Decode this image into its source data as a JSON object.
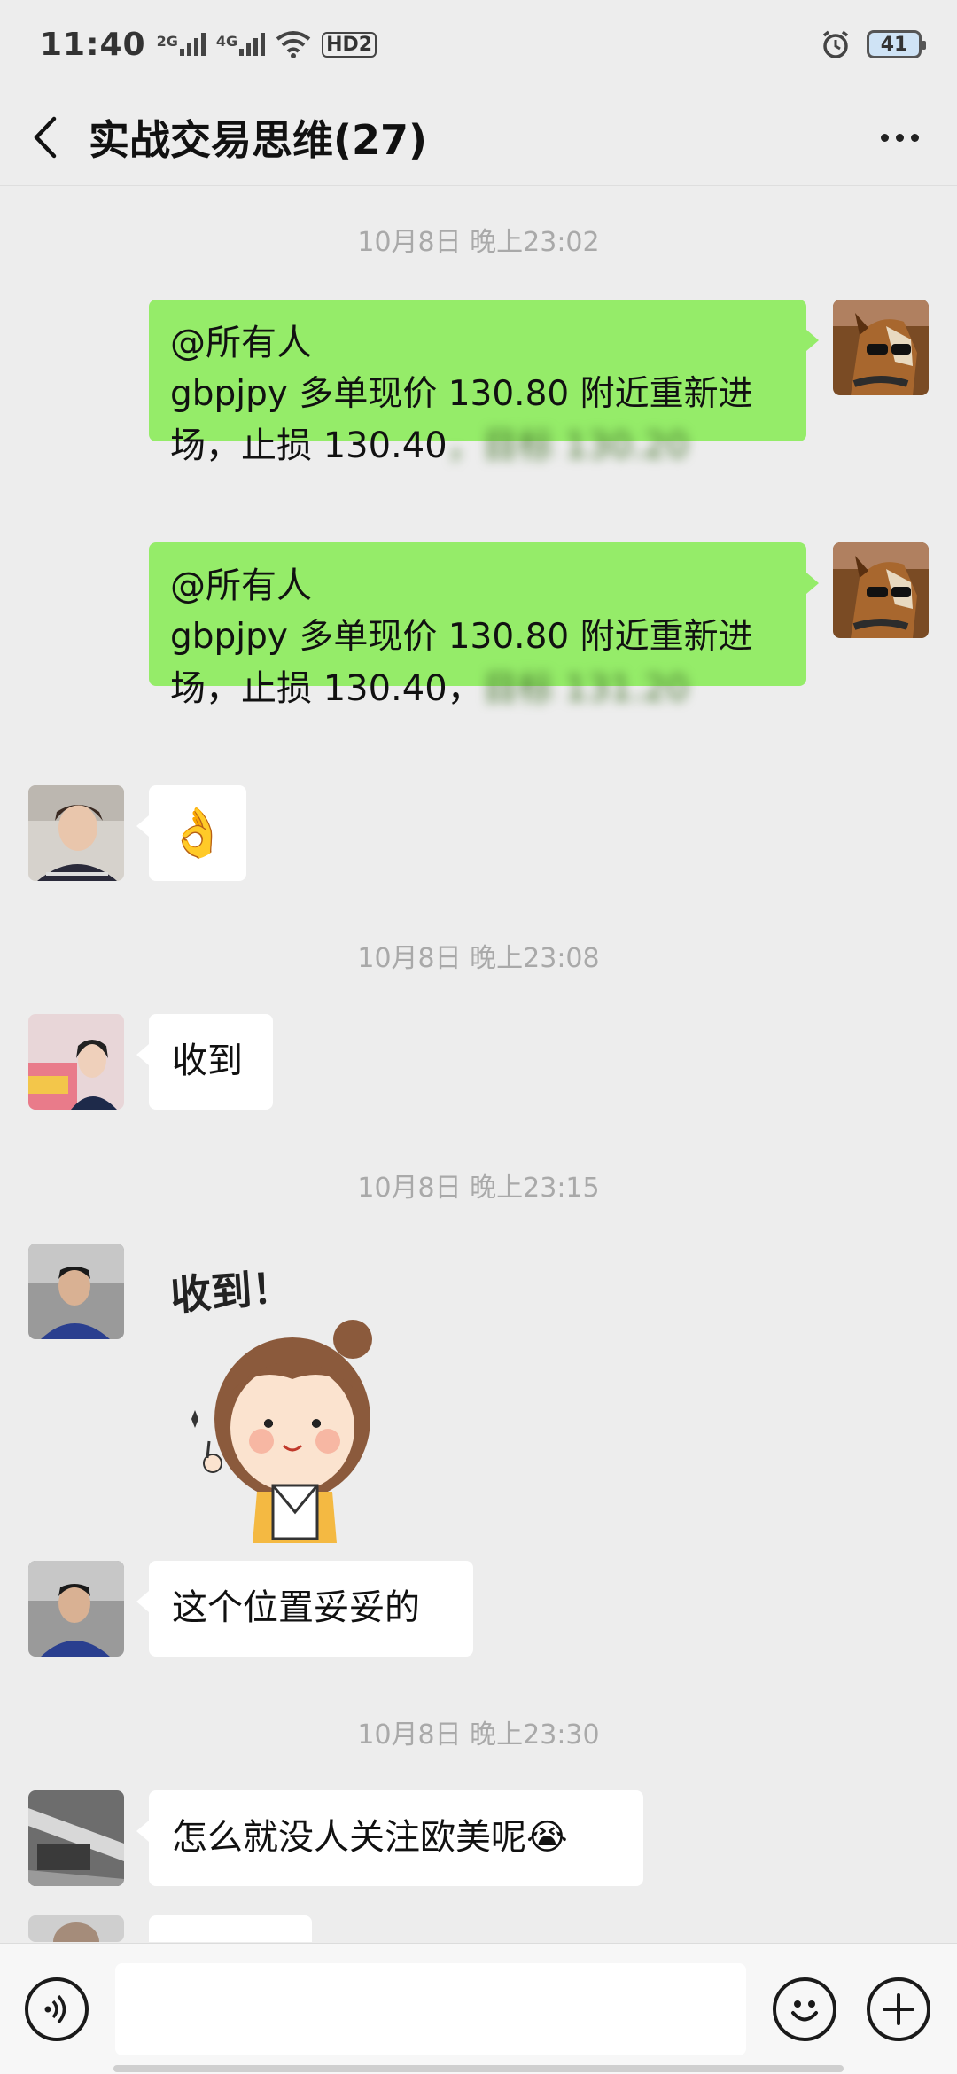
{
  "status_bar": {
    "time": "11:40",
    "net1": "2G",
    "net2": "4G",
    "hd": "HD2",
    "battery": "41"
  },
  "header": {
    "title": "实战交易思维(27)"
  },
  "messages": {
    "ts1": "10月8日 晚上23:02",
    "m1": {
      "line1": "@所有人",
      "line2": "gbpjpy 多单现价 130.80 附近重新进",
      "line3": "场，止损 130.40",
      "line3_hidden": "，目标 130.20"
    },
    "m2": {
      "line1": "@所有人",
      "line2": "gbpjpy 多单现价 130.80 附近重新进",
      "line3": "场，止损 130.40，",
      "line3_hidden": "目标 131.20"
    },
    "m3": {
      "emoji": "👌"
    },
    "ts2": "10月8日 晚上23:08",
    "m4": {
      "text": "收到"
    },
    "ts3": "10月8日 晚上23:15",
    "m5": {
      "sticker_text": "收到！"
    },
    "m6": {
      "text": "这个位置妥妥的"
    },
    "ts4": "10月8日 晚上23:30",
    "m7": {
      "text": "怎么就没人关注欧美呢",
      "emoji": "😭"
    }
  },
  "input": {
    "placeholder": ""
  },
  "colors": {
    "my_bubble": "#95ec69",
    "other_bubble": "#ffffff",
    "background": "#ededed"
  }
}
